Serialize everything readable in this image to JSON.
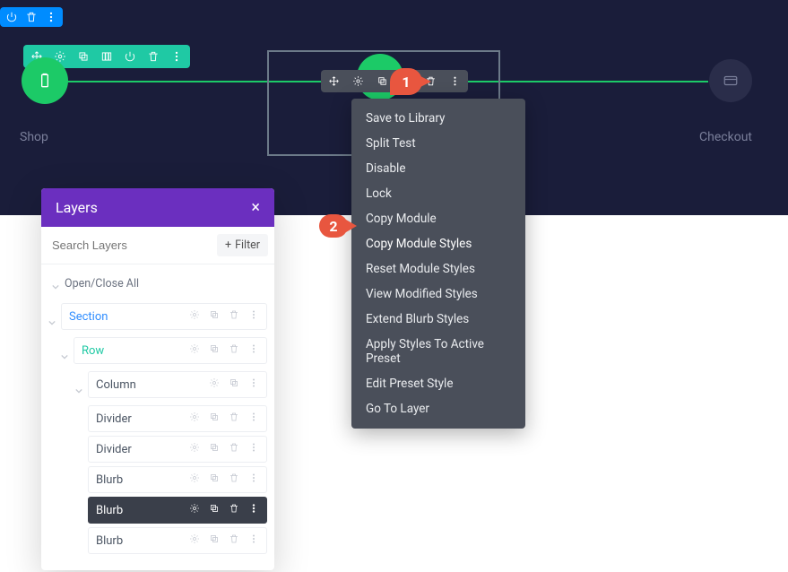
{
  "hero": {
    "shop_label": "Shop",
    "checkout_label": "Checkout"
  },
  "markers": {
    "one": "1",
    "two": "2"
  },
  "context_menu": {
    "items": [
      "Save to Library",
      "Split Test",
      "Disable",
      "Lock",
      "Copy Module",
      "Copy Module Styles",
      "Reset Module Styles",
      "View Modified Styles",
      "Extend Blurb Styles",
      "Apply Styles To Active Preset",
      "Edit Preset Style",
      "Go To Layer"
    ],
    "highlight_index": 5
  },
  "layers": {
    "title": "Layers",
    "search_placeholder": "Search Layers",
    "filter_label": "Filter",
    "open_close_label": "Open/Close All",
    "tree": {
      "section": "Section",
      "row": "Row",
      "column": "Column",
      "items": [
        "Divider",
        "Divider",
        "Blurb",
        "Blurb",
        "Blurb"
      ],
      "active_index": 3
    }
  }
}
